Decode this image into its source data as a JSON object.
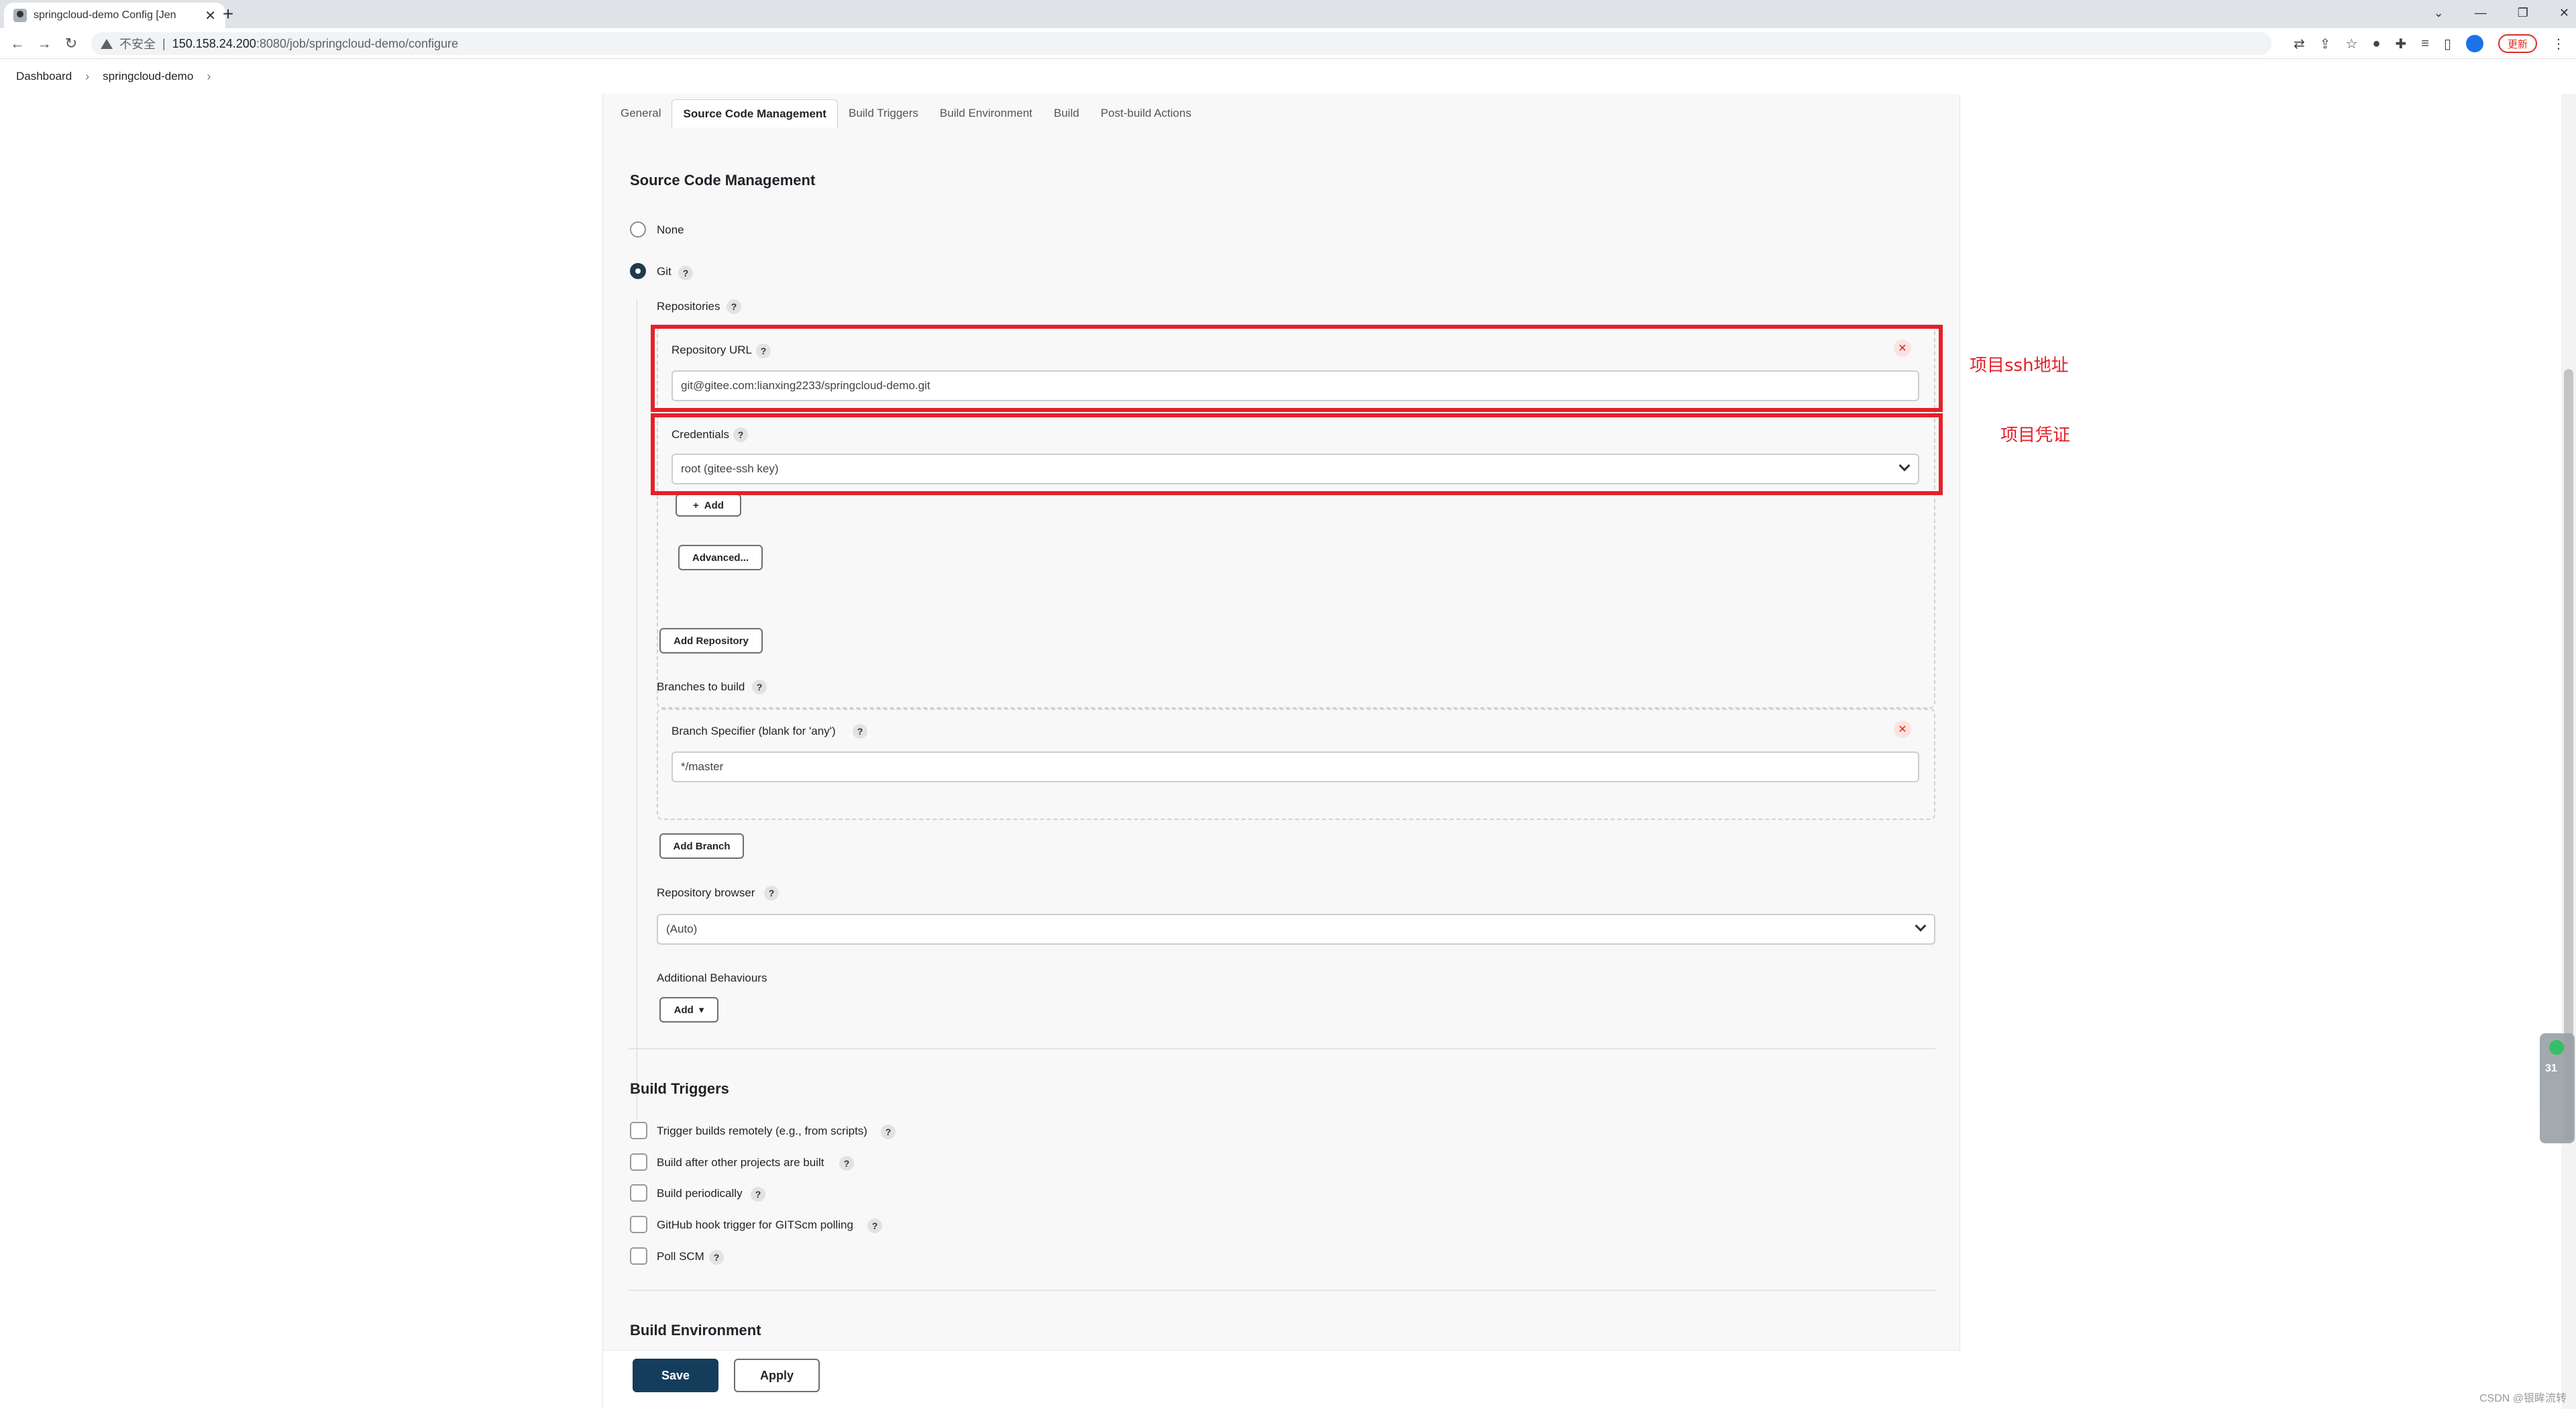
{
  "browser": {
    "tab_title": "springcloud-demo Config [Jen",
    "tab_close": "✕",
    "new_tab": "+",
    "insecure_label": "不安全",
    "url_host": "150.158.24.200",
    "url_path": ":8080/job/springcloud-demo/configure",
    "update_label": "更新",
    "win_min": "—",
    "win_restore": "❐",
    "win_close": "✕"
  },
  "breadcrumbs": [
    "Dashboard",
    "springcloud-demo"
  ],
  "tabs": [
    "General",
    "Source Code Management",
    "Build Triggers",
    "Build Environment",
    "Build",
    "Post-build Actions"
  ],
  "scm": {
    "title": "Source Code Management",
    "option_none": "None",
    "option_git": "Git",
    "repositories_label": "Repositories",
    "repository_url_label": "Repository URL",
    "repository_url_value": "git@gitee.com:lianxing2233/springcloud-demo.git",
    "credentials_label": "Credentials",
    "credentials_value": "root (gitee-ssh key)",
    "add_label": "Add",
    "advanced_label": "Advanced...",
    "add_repository_label": "Add Repository",
    "branches_label": "Branches to build",
    "branch_specifier_label": "Branch Specifier (blank for 'any')",
    "branch_specifier_value": "*/master",
    "add_branch_label": "Add Branch",
    "repo_browser_label": "Repository browser",
    "repo_browser_value": "(Auto)",
    "additional_behaviours_label": "Additional Behaviours",
    "add_dropdown_label": "Add"
  },
  "build_triggers": {
    "title": "Build Triggers",
    "items": [
      "Trigger builds remotely (e.g., from scripts)",
      "Build after other projects are built",
      "Build periodically",
      "GitHub hook trigger for GITScm polling",
      "Poll SCM"
    ]
  },
  "build_environment": {
    "title": "Build Environment"
  },
  "actions": {
    "save_label": "Save",
    "apply_label": "Apply"
  },
  "annotations": {
    "url_note": "项目ssh地址",
    "credentials_note": "项目凭证"
  },
  "widget": {
    "number": "31"
  },
  "watermark": "CSDN @银眸流转",
  "colors": {
    "annotation": "#e5202a",
    "save_button": "#143d5c",
    "radio_checked": "#1d3b4f"
  }
}
